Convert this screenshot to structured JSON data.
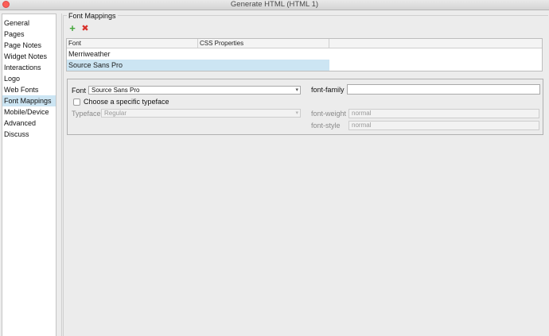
{
  "window": {
    "title": "Generate HTML (HTML 1)"
  },
  "sidebar": {
    "items": [
      {
        "label": "General"
      },
      {
        "label": "Pages"
      },
      {
        "label": "Page Notes"
      },
      {
        "label": "Widget Notes"
      },
      {
        "label": "Interactions"
      },
      {
        "label": "Logo"
      },
      {
        "label": "Web Fonts"
      },
      {
        "label": "Font Mappings",
        "selected": true
      },
      {
        "label": "Mobile/Device"
      },
      {
        "label": "Advanced"
      },
      {
        "label": "Discuss"
      }
    ]
  },
  "font_mappings": {
    "title": "Font Mappings",
    "toolbar": {
      "add_icon": "plus-icon",
      "delete_icon": "x-icon",
      "add_color": "#43a53a",
      "delete_color": "#d8322c"
    },
    "table": {
      "columns": [
        "Font",
        "CSS Properties"
      ],
      "rows": [
        {
          "font": "Merriweather",
          "css": ""
        },
        {
          "font": "Source Sans Pro",
          "css": "",
          "selected": true
        }
      ]
    }
  },
  "details": {
    "font_label": "Font",
    "font_value": "Source Sans Pro",
    "specific_typeface_label": "Choose a specific typeface",
    "specific_typeface_checked": false,
    "typeface_label": "Typeface",
    "typeface_value": "Regular",
    "font_family_label": "font-family",
    "font_family_value": "",
    "font_weight_label": "font-weight",
    "font_weight_placeholder": "normal",
    "font_style_label": "font-style",
    "font_style_placeholder": "normal"
  },
  "colors": {
    "selection": "#cce5f3",
    "close_button": "#fc5f57"
  }
}
